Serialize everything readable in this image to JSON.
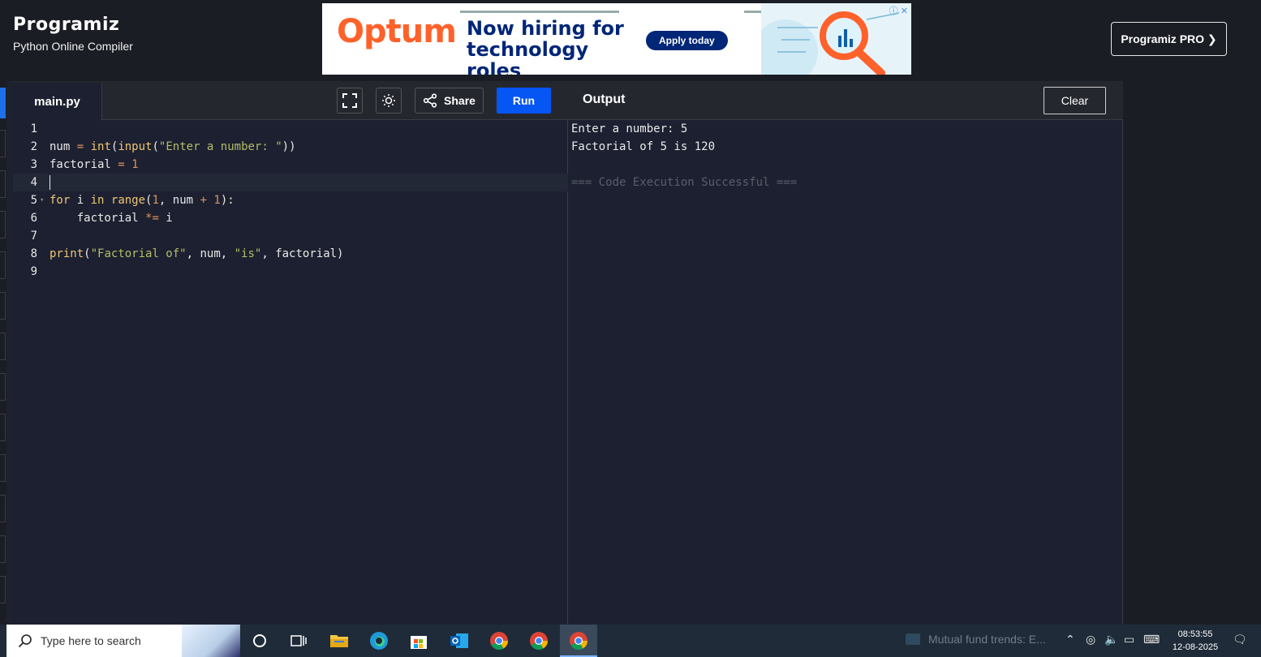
{
  "header": {
    "logo_text": "Programiz",
    "subtitle": "Python Online Compiler",
    "pro_button": "Programiz PRO ❯"
  },
  "ad": {
    "brand": "Optum",
    "headline": "Now hiring for technology roles",
    "cta": "Apply today"
  },
  "editor": {
    "tab_label": "main.py",
    "share_label": "Share",
    "run_label": "Run",
    "lines": [
      {
        "n": "1",
        "code": ""
      },
      {
        "n": "2",
        "code": "num = int(input(\"Enter a number: \"))"
      },
      {
        "n": "3",
        "code": "factorial = 1"
      },
      {
        "n": "4",
        "code": ""
      },
      {
        "n": "5",
        "code": "for i in range(1, num + 1):"
      },
      {
        "n": "6",
        "code": "    factorial *= i"
      },
      {
        "n": "7",
        "code": ""
      },
      {
        "n": "8",
        "code": "print(\"Factorial of\", num, \"is\", factorial)"
      },
      {
        "n": "9",
        "code": ""
      }
    ]
  },
  "output": {
    "title": "Output",
    "clear_label": "Clear",
    "line1": "Enter a number: 5",
    "line2": "Factorial of 5 is 120",
    "line3": "",
    "line4": "=== Code Execution Successful ==="
  },
  "taskbar": {
    "search_placeholder": "Type here to search",
    "news_text": "Mutual fund trends: E...",
    "time": "08:53:55",
    "date": "12-08-2025"
  },
  "colors": {
    "run_button": "#0556f3",
    "optum_orange": "#ff612b",
    "optum_blue": "#002677"
  }
}
